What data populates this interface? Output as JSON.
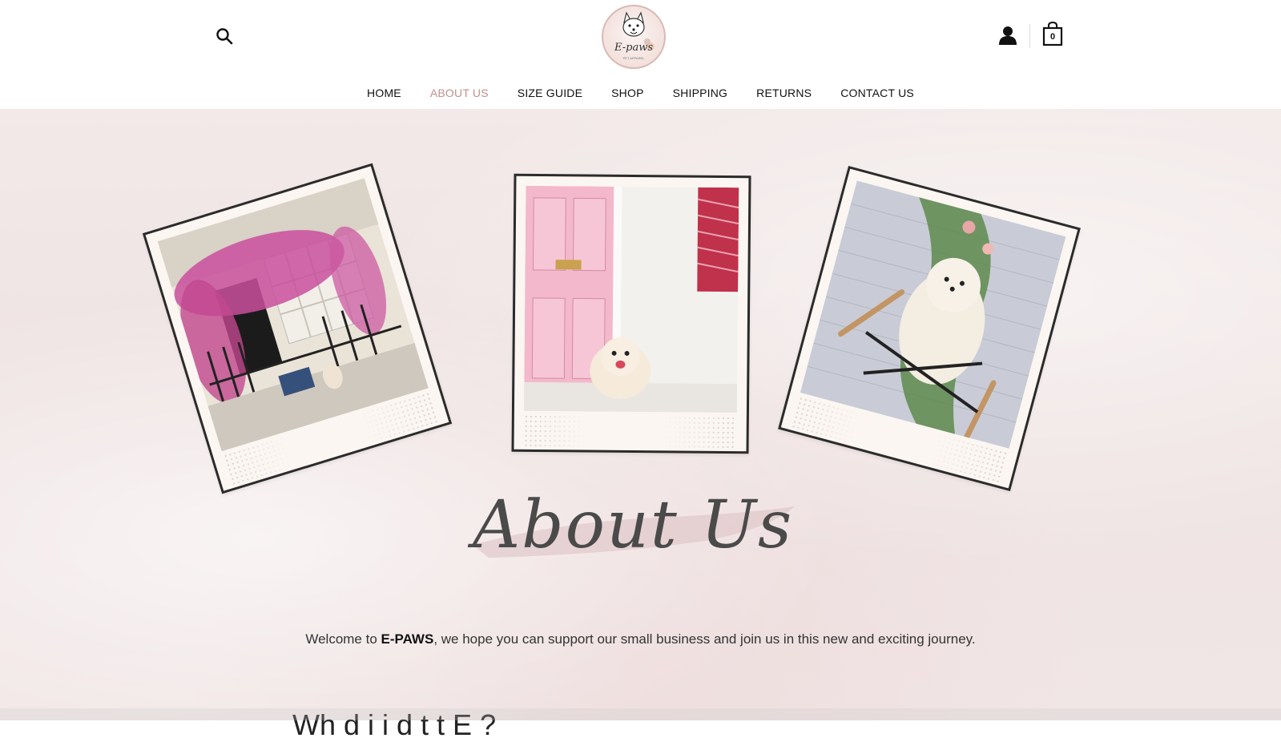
{
  "header": {
    "logo": {
      "text": "E-paws",
      "subtext": "PET APPAREL"
    },
    "cart_count": "0",
    "icons": {
      "search": "search-icon",
      "account": "user-icon",
      "cart": "shopping-bag-icon"
    }
  },
  "nav": {
    "items": [
      {
        "label": "HOME"
      },
      {
        "label": "ABOUT US",
        "active": true
      },
      {
        "label": "SIZE GUIDE"
      },
      {
        "label": "SHOP"
      },
      {
        "label": "SHIPPING"
      },
      {
        "label": "RETURNS"
      },
      {
        "label": "CONTACT US"
      }
    ],
    "active_color": "#c48f8f"
  },
  "hero": {
    "title": "About Us"
  },
  "intro": {
    "before": "Welcome to ",
    "brand": "E-PAWS",
    "after": ", we hope you can support our small business and join us in this new and exciting journey."
  },
  "next_section": {
    "heading": "Wh                d     i   i  d     t    t  E      ?"
  },
  "colors": {
    "accent": "#c48f8f",
    "background": "#f2e9e8",
    "text": "#222222"
  }
}
